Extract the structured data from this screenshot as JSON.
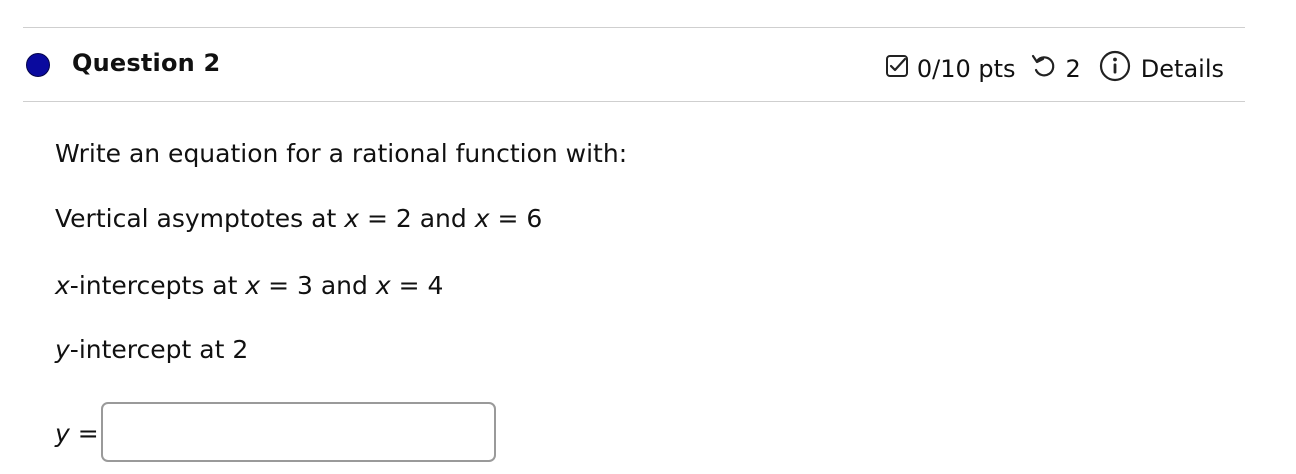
{
  "question": {
    "title": "Question 2",
    "points": "0/10 pts",
    "attempts": "2",
    "details_label": "Details"
  },
  "prompt": {
    "intro": "Write an equation for a rational function with:",
    "vertical_asymptotes": {
      "text": "Vertical asymptotes at ",
      "var1": "x",
      "eq1": " = 2 and ",
      "var2": "x",
      "eq2": " = 6"
    },
    "x_intercepts": {
      "var0": "x",
      "text": "-intercepts at ",
      "var1": "x",
      "eq1": " = 3 and ",
      "var2": "x",
      "eq2": " = 4"
    },
    "y_intercept": {
      "var0": "y",
      "text": "-intercept at 2"
    }
  },
  "answer": {
    "var": "y",
    "equals": " =",
    "value": "",
    "placeholder": ""
  },
  "colors": {
    "status_dot": "#0a0a9e",
    "rule": "#cfcfcf",
    "input_border": "#9a9a9a"
  },
  "icons": [
    "status-dot",
    "checkbox-icon",
    "retry-icon",
    "info-icon"
  ]
}
